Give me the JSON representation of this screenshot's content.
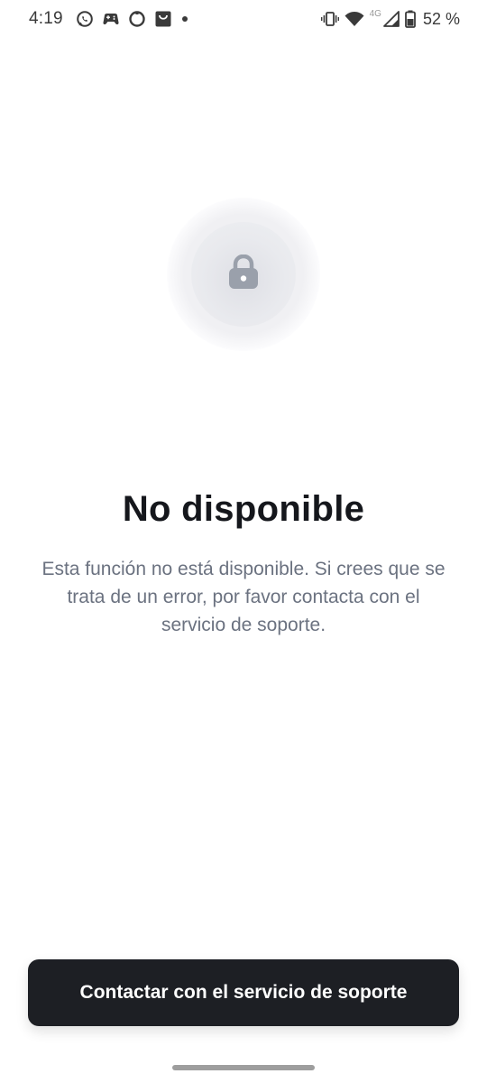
{
  "status_bar": {
    "time": "4:19",
    "network_label": "4G",
    "battery_percent": "52 %",
    "left_icons": [
      "whatsapp-icon",
      "game-controller-icon",
      "circle-app-icon",
      "shopping-bag-icon",
      "dot-icon"
    ],
    "right_icons": [
      "vibrate-icon",
      "wifi-icon",
      "signal-icon",
      "battery-icon"
    ]
  },
  "main": {
    "icon": "lock-icon",
    "title": "No disponible",
    "message": "Esta función no está disponible. Si crees que se trata de un error, por favor contacta con el servicio de soporte."
  },
  "footer": {
    "button_label": "Contactar con el servicio de soporte"
  },
  "colors": {
    "background": "#ffffff",
    "title": "#15171c",
    "message": "#6b7280",
    "button_bg": "#1d1f24",
    "button_text": "#ffffff",
    "lock_icon": "#9aa0ab"
  }
}
